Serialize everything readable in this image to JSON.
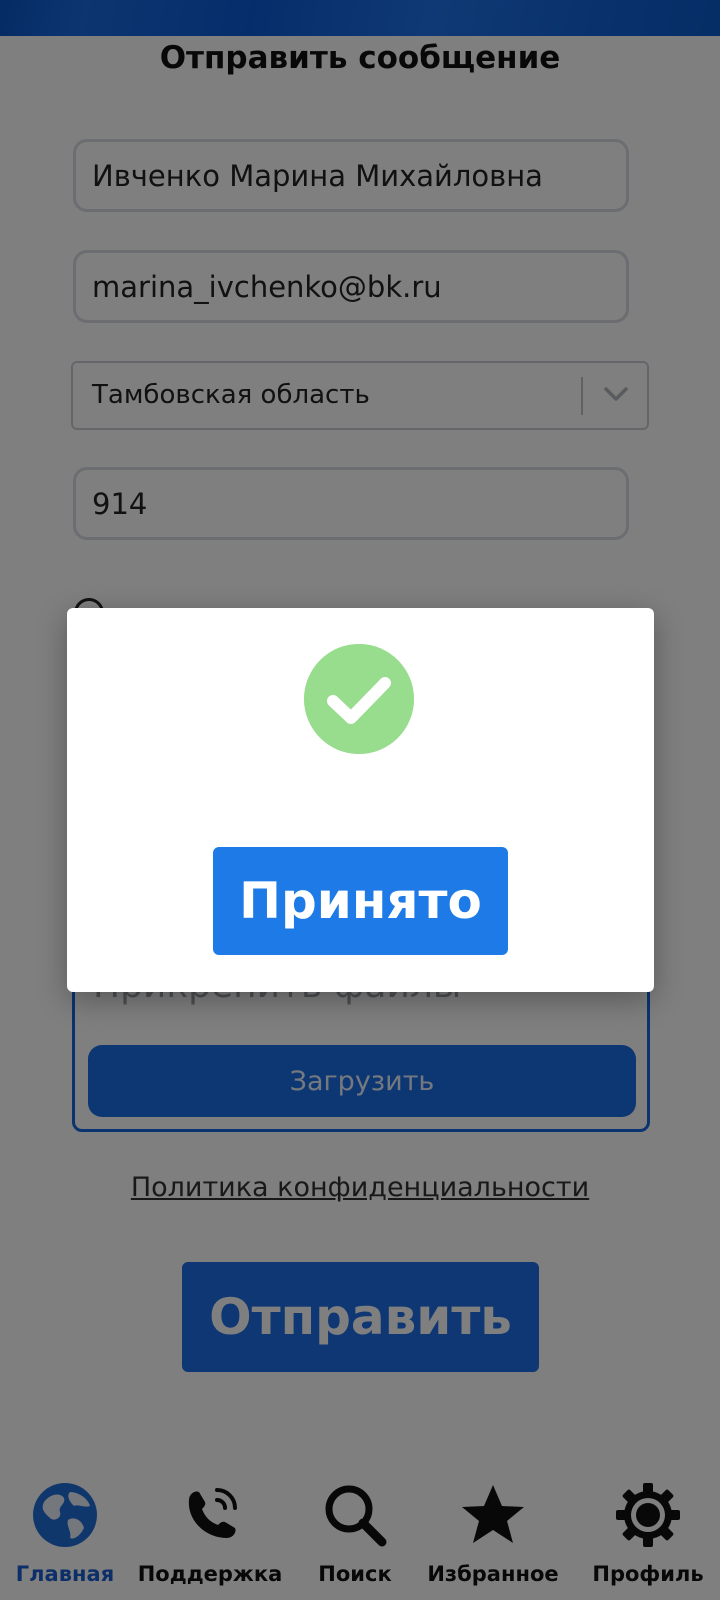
{
  "form": {
    "title": "Отправить сообщение",
    "name_value": "Ивченко Марина Михайловна",
    "email_value": "marina_ivchenko@bk.ru",
    "region_value": "Тамбовская область",
    "code_value": "914",
    "attach_label": "Прикрепить файлы",
    "upload_label": "Загрузить",
    "privacy_label": "Политика конфиденциальности",
    "send_label": "Отправить"
  },
  "modal": {
    "accept_label": "Принято",
    "icon": "checkmark-icon",
    "icon_color": "#98dc8e",
    "button_color": "#1e7ae6"
  },
  "bottom_nav": {
    "items": [
      {
        "label": "Главная",
        "icon": "globe-icon",
        "active": true
      },
      {
        "label": "Поддержка",
        "icon": "phone-icon"
      },
      {
        "label": "Поиск",
        "icon": "search-icon"
      },
      {
        "label": "Избранное",
        "icon": "star-icon"
      },
      {
        "label": "Профиль",
        "icon": "gear-icon"
      }
    ]
  },
  "colors": {
    "accent": "#1f6fe6",
    "active_nav": "#1b5fd2",
    "header": "#0b5bd6"
  }
}
